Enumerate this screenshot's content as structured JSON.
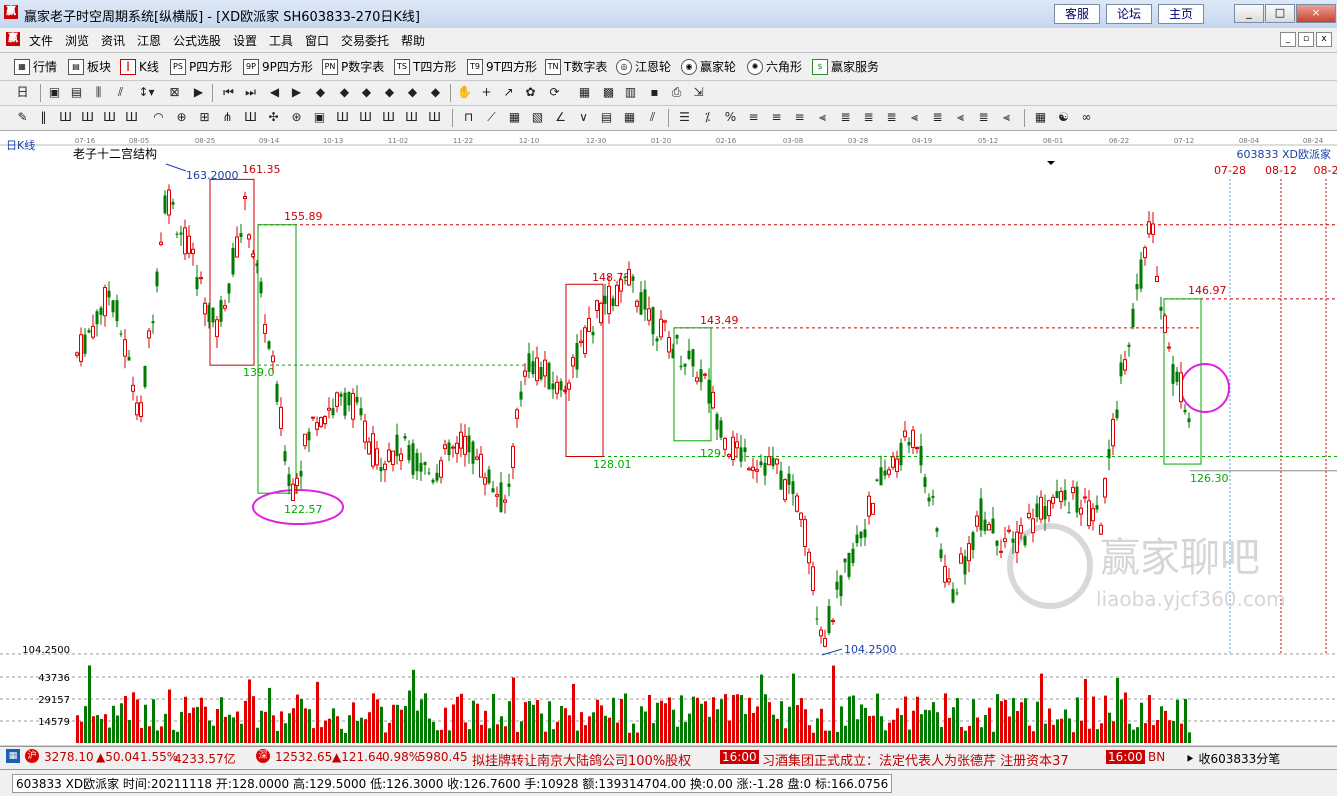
{
  "window": {
    "title": "赢家老子时空周期系统[纵横版] - [XD欧派家  SH603833-270日K线]",
    "links": [
      "客服",
      "论坛",
      "主页"
    ],
    "controls": [
      "_",
      "□",
      "×"
    ]
  },
  "menu": [
    "文件",
    "浏览",
    "资讯",
    "江恩",
    "公式选股",
    "设置",
    "工具",
    "窗口",
    "交易委托",
    "帮助"
  ],
  "toolbar1": [
    "行情",
    "板块",
    "K线",
    "P四方形",
    "9P四方形",
    "P数字表",
    "T四方形",
    "9T四方形",
    "T数字表",
    "江恩轮",
    "赢家轮",
    "六角形",
    "赢家服务"
  ],
  "toolbar1_icons": [
    "PS",
    "9P",
    "PN",
    "TS",
    "T9",
    "TN"
  ],
  "chart": {
    "period_label": "日K线",
    "indicator_name": "老子十二宫结构",
    "stock_label": "603833 XD欧派家",
    "top_dates": [
      "07-16",
      "08-05",
      "08-25",
      "09-14",
      "10-13",
      "11-02",
      "11-22",
      "12-10",
      "12-30",
      "01-20",
      "02-16",
      "03-08",
      "03-28",
      "04-19",
      "05-12",
      "06-01",
      "06-22",
      "07-12",
      "08-04",
      "08-24"
    ],
    "future_dates": [
      "07-28",
      "08-12",
      "08-2"
    ],
    "price_low_axis": "104.2500",
    "annotations": {
      "p163": "163.2000",
      "p161": "161.35",
      "p155": "155.89",
      "p148": "148.73",
      "p146": "146.97",
      "p143": "143.49",
      "p139": "139.0",
      "p129": "129.",
      "p128": "128.01",
      "p126": "126.30",
      "p122": "122.57",
      "p104": "104.2500"
    },
    "volume_labels": [
      "43736",
      "29157",
      "14579"
    ],
    "watermark_cn": "赢家聊吧",
    "watermark_en": "liaoba.yjcf360.com"
  },
  "status1": {
    "sh_value": "3278.10",
    "sh_change": "▲50.04",
    "sh_pct": "1.55%",
    "sh_amount": "4233.57亿",
    "sz_value": "12532.65",
    "sz_change": "▲121.64",
    "sz_pct": "0.98%",
    "sz_amount": "5980.45",
    "news1": "拟挂牌转让南京大陆鸽公司100%股权",
    "time1": "16:00",
    "news2": "习酒集团正式成立：法定代表人为张德芹 注册资本37",
    "time2": "16:00",
    "tail": "BN",
    "follow": "收603833分笔"
  },
  "status2": {
    "info": "603833 XD欧派家 时间:20211118 开:128.0000 高:129.5000 低:126.3000 收:126.7600 手:10928 额:139314704.00 换:0.00 涨:-1.28 盘:0 标:166.0756"
  }
}
